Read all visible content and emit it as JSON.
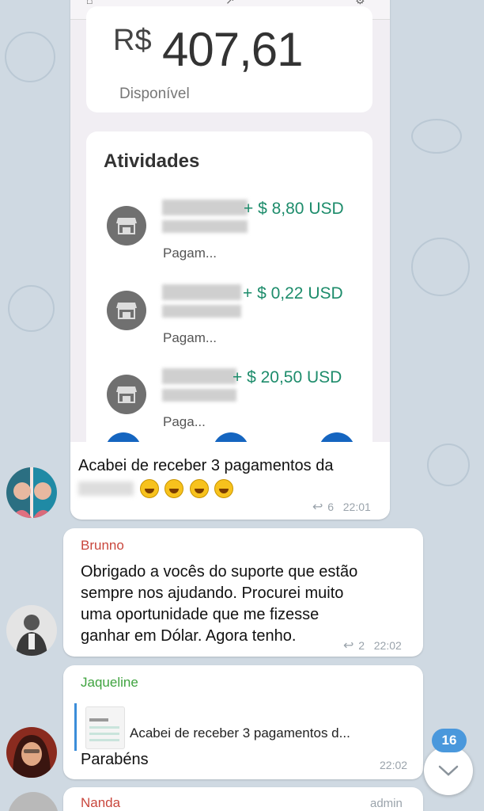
{
  "screenshot": {
    "currency": "R$",
    "balance": "407,61",
    "balance_label": "Disponível",
    "activities_title": "Atividades",
    "activities": [
      {
        "amount": "+ $ 8,80 USD",
        "subtitle": "Pagam..."
      },
      {
        "amount": "+ $ 0,22 USD",
        "subtitle": "Pagam..."
      },
      {
        "amount": "+ $ 20,50 USD",
        "subtitle": "Paga..."
      }
    ]
  },
  "messages": [
    {
      "caption": "Acabei de receber 3 pagamentos da",
      "replies": "6",
      "time": "22:01"
    },
    {
      "sender": "Brunno",
      "sender_color": "#c9473d",
      "lines": [
        "Obrigado a vocês do suporte que estão",
        "sempre nos ajudando. Procurei muito",
        "uma oportunidade que me fizesse",
        "ganhar em Dólar. Agora tenho."
      ],
      "replies": "2",
      "time": "22:02"
    },
    {
      "sender": "Jaqueline",
      "sender_color": "#3fa33f",
      "quote": "Acabei de receber 3 pagamentos d...",
      "text": "Parabéns",
      "time": "22:02"
    },
    {
      "sender": "Nanda",
      "sender_color": "#c9473d",
      "role": "admin"
    }
  ],
  "unread_badge": "16",
  "colors": {
    "accent": "#4a98dc",
    "income_green": "#1d8c6b",
    "chat_background": "#cfd9e2"
  }
}
